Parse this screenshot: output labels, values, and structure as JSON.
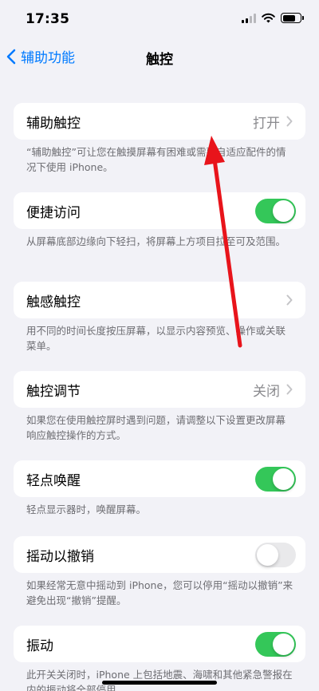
{
  "status_bar": {
    "time": "17:35"
  },
  "nav": {
    "back_label": "辅助功能",
    "title": "触控"
  },
  "rows": [
    {
      "label": "辅助触控",
      "value": "打开",
      "desc": "“辅助触控”可让您在触摸屏幕有困难或需要自适应配件的情况下使用 iPhone。"
    },
    {
      "label": "便捷访问",
      "toggle": "on",
      "desc": "从屏幕底部边缘向下轻扫，将屏幕上方项目拉至可及范围。"
    },
    {
      "label": "触感触控",
      "desc": "用不同的时间长度按压屏幕，以显示内容预览、操作或关联菜单。"
    },
    {
      "label": "触控调节",
      "value": "关闭",
      "desc": "如果您在使用触控屏时遇到问题，请调整以下设置更改屏幕响应触控操作的方式。"
    },
    {
      "label": "轻点唤醒",
      "toggle": "on",
      "desc": "轻点显示器时，唤醒屏幕。"
    },
    {
      "label": "摇动以撤销",
      "toggle": "off",
      "desc": "如果经常无意中摇动到 iPhone，您可以停用“摇动以撤销”来避免出现“撤销”提醒。"
    },
    {
      "label": "振动",
      "toggle": "on",
      "desc": "此开关关闭时，iPhone 上包括地震、海啸和其他紧急警报在内的振动将全部停用。"
    }
  ],
  "colors": {
    "accent": "#007aff",
    "toggle_on": "#34c759",
    "arrow": "#e8141b"
  }
}
